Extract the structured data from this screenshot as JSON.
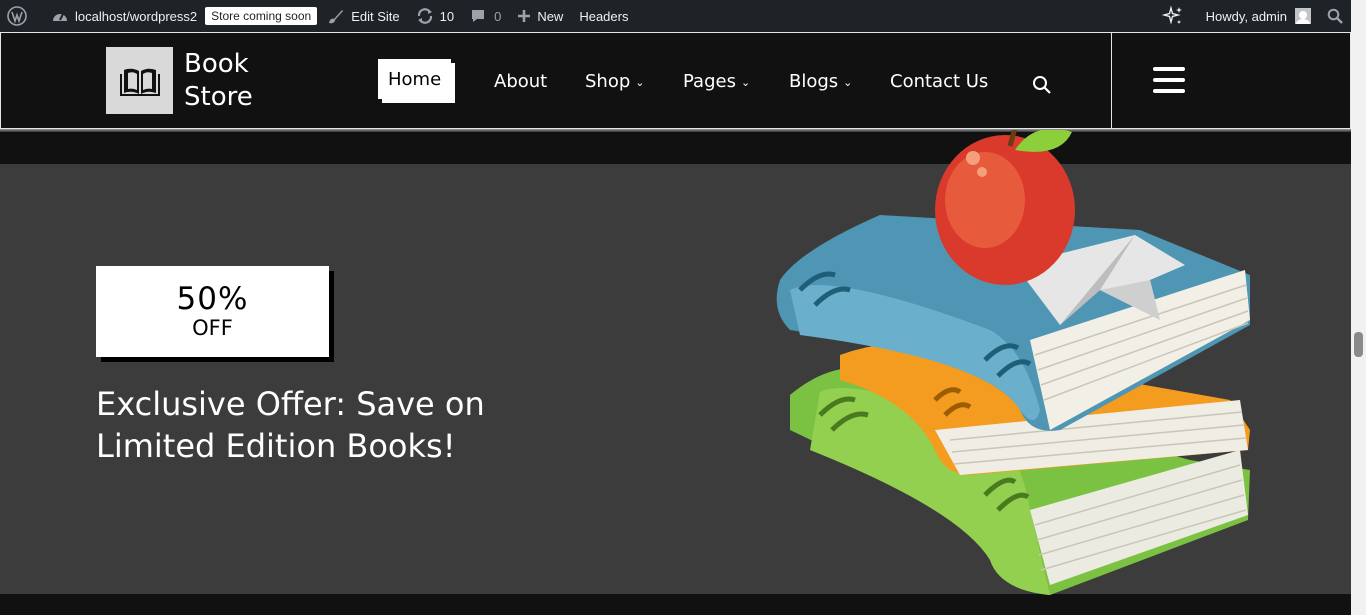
{
  "admin_bar": {
    "site_url": "localhost/wordpress2",
    "store_badge": "Store coming soon",
    "edit_site": "Edit Site",
    "updates_count": "10",
    "comments_count": "0",
    "new_label": "New",
    "headers_label": "Headers",
    "howdy": "Howdy, admin"
  },
  "header": {
    "logo_line1": "Book",
    "logo_line2": "Store",
    "nav": [
      {
        "label": "Home",
        "active": true
      },
      {
        "label": "About"
      },
      {
        "label": "Shop",
        "dropdown": true
      },
      {
        "label": "Pages",
        "dropdown": true
      },
      {
        "label": "Blogs",
        "dropdown": true
      },
      {
        "label": "Contact Us"
      }
    ]
  },
  "hero": {
    "badge_percent": "50%",
    "badge_off": "OFF",
    "title": "Exclusive Offer: Save on Limited Edition Books!"
  },
  "icons": {
    "wordpress": "wordpress-logo-icon",
    "dashboard": "dashboard-icon",
    "edit": "brush-icon",
    "updates": "refresh-icon",
    "comments": "comment-icon",
    "new": "plus-icon",
    "ai": "sparkle-icon",
    "search": "search-icon",
    "menu": "hamburger-icon"
  },
  "colors": {
    "adminbar_bg": "#1d2327",
    "header_bg": "#111111",
    "hero_bg": "#3c3c3c",
    "accent": "#ffffff"
  }
}
